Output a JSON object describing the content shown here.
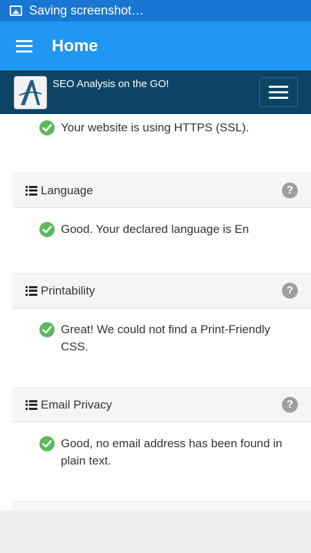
{
  "status_bar": {
    "text": "Saving screenshot…"
  },
  "app_bar": {
    "title": "Home"
  },
  "site_header": {
    "title": "SEO Analysis on the GO!"
  },
  "top_result": {
    "text": "Your website is using HTTPS (SSL)."
  },
  "sections": [
    {
      "title": "Language",
      "result": "Good. Your declared language is En"
    },
    {
      "title": "Printability",
      "result": "Great! We could not find a Print-Friendly CSS."
    },
    {
      "title": "Email Privacy",
      "result": "Good, no email address has been found in plain text."
    }
  ],
  "colors": {
    "status_bar": "#1976d2",
    "app_bar": "#2196f3",
    "site_header": "#0d4466",
    "success": "#5cb85c",
    "help": "#9e9e9e"
  },
  "icons": [
    "image-icon",
    "menu-icon",
    "logo",
    "list-icon",
    "check-circle-icon",
    "question-circle-icon"
  ]
}
